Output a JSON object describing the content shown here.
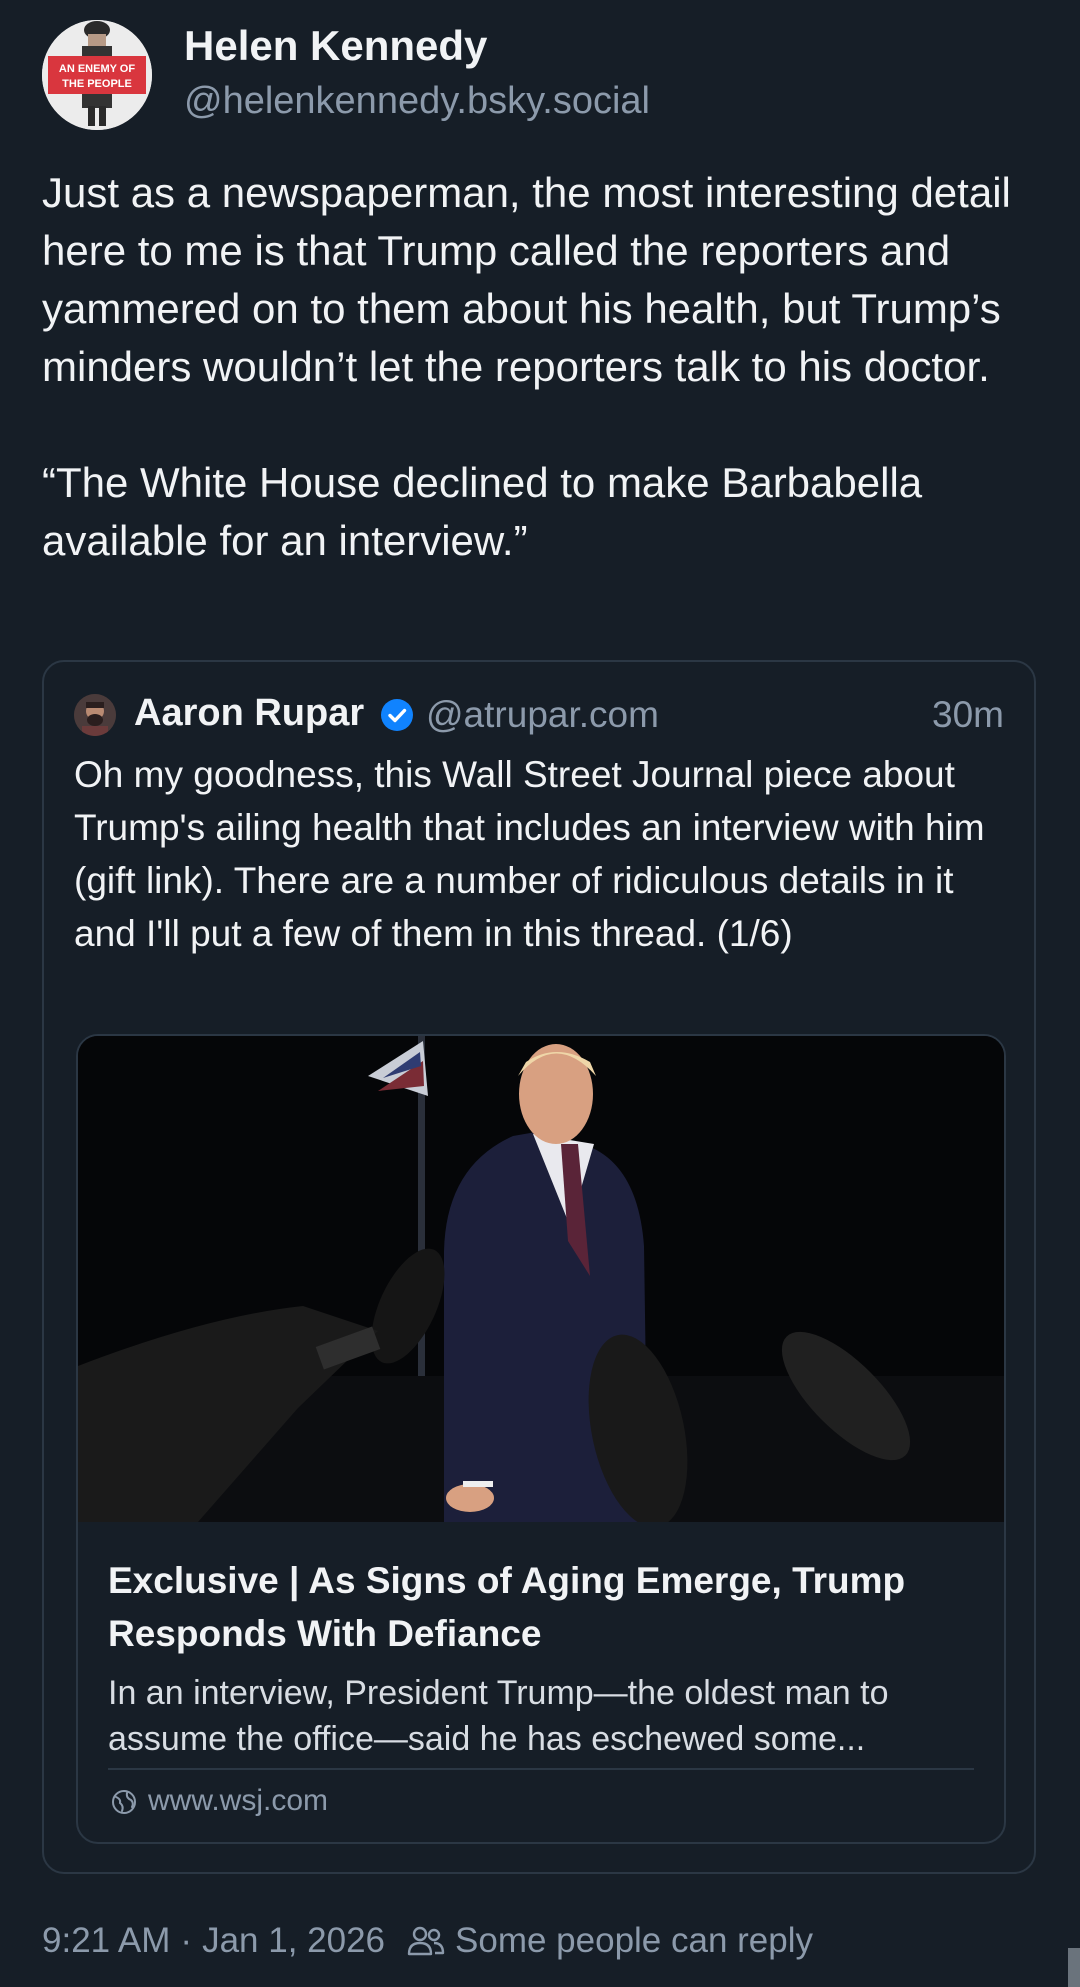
{
  "author": {
    "name": "Helen Kennedy",
    "handle": "@helenkennedy.bsky.social",
    "avatar_badge_line1": "AN ENEMY OF",
    "avatar_badge_line2": "THE PEOPLE"
  },
  "post": {
    "text": "Just as a newspaperman, the most interesting detail here to me is that Trump called the reporters and yammered on to them about his health, but Trump’s minders wouldn’t let the reporters talk to his doctor.\n\n“The White House declined to make Barbabella available for an interview.”"
  },
  "quote": {
    "author_name": "Aaron Rupar",
    "author_handle": "@atrupar.com",
    "time": "30m",
    "verified_icon": "verified-check-icon",
    "text": "Oh my goodness, this Wall Street Journal piece about Trump's ailing health that includes an interview with him (gift link). There are a number of ridiculous details in it and I'll put a few of them in this thread. (1/6)",
    "link_card": {
      "title": "Exclusive | As Signs of Aging Emerge, Trump Responds With Defiance",
      "description": "In an interview, President Trump—the oldest man to assume the office—said he has eschewed some...",
      "domain": "www.wsj.com",
      "domain_icon": "globe-icon"
    }
  },
  "footer": {
    "time": "9:21 AM",
    "separator": "·",
    "date": "Jan 1, 2026",
    "reply_icon": "people-icon",
    "reply_setting": "Some people can reply"
  },
  "colors": {
    "background": "#161e27",
    "text": "#f1f3f5",
    "muted": "#8c9aab",
    "border": "#2b3744",
    "verified": "#1083fe"
  }
}
